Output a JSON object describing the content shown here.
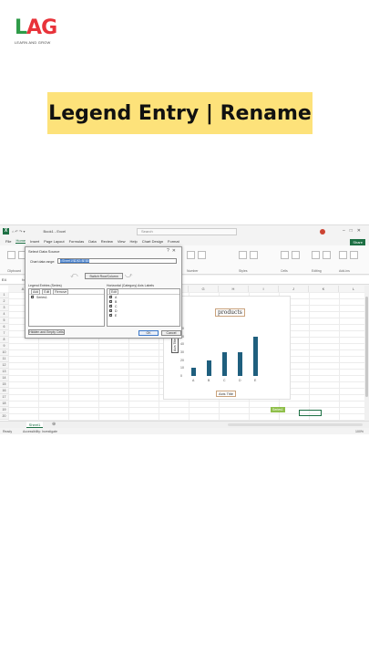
{
  "logo": {
    "main_l": "L",
    "main_a": "A",
    "main_g": "G",
    "tagline": "LEARN AND GROW"
  },
  "banner": {
    "title": "Legend Entry | Rename"
  },
  "excel": {
    "file_name": "Book1 - Excel",
    "search_placeholder": "Search",
    "menu": [
      "File",
      "Home",
      "Insert",
      "Page Layout",
      "Formulas",
      "Data",
      "Review",
      "View",
      "Help",
      "Chart Design",
      "Format"
    ],
    "active_menu": "Home",
    "share": "Share",
    "ribbon_groups": [
      "Clipboard",
      "Font",
      "Alignment",
      "Number",
      "Styles",
      "Cells",
      "Editing",
      "Add-ins"
    ],
    "name_box": "E4",
    "fx": "fx",
    "columns": [
      "A",
      "B",
      "C",
      "D",
      "E",
      "F",
      "G",
      "H",
      "I",
      "J",
      "K",
      "L",
      "M",
      "N",
      "O",
      "P"
    ],
    "rows": [
      "1",
      "2",
      "3",
      "4",
      "5",
      "6",
      "7",
      "8",
      "9",
      "10",
      "11",
      "12",
      "13",
      "14",
      "15",
      "16",
      "17",
      "18",
      "19",
      "20"
    ],
    "sheet_tab": "Sheet1",
    "status_ready": "Ready",
    "status_accessibility": "Accessibility: Investigate",
    "zoom": "100%"
  },
  "chart": {
    "title": "products",
    "x_axis_title": "Axis Title",
    "y_axis_title": "Axis Title",
    "legend_tag": "Series1",
    "categories": [
      "A",
      "B",
      "C",
      "D",
      "E"
    ],
    "values": [
      10,
      20,
      30,
      30,
      50
    ],
    "y_ticks": [
      "60",
      "50",
      "40",
      "30",
      "20",
      "10",
      "0"
    ],
    "bar_color": "#1f5f7e"
  },
  "dialog": {
    "title": "Select Data Source",
    "range_label": "Chart data range:",
    "range_value": "=Sheet1!$D$3:$E$8",
    "switch_button": "Switch Row/Column",
    "legend_panel_title": "Legend Entries (Series)",
    "axis_panel_title": "Horizontal (Category) Axis Labels",
    "add": "Add",
    "edit": "Edit",
    "remove": "Remove",
    "series": [
      "Series1"
    ],
    "axis_labels": [
      "A",
      "B",
      "C",
      "D",
      "E"
    ],
    "hidden_button": "Hidden and Empty Cells",
    "ok": "OK",
    "cancel": "Cancel"
  }
}
